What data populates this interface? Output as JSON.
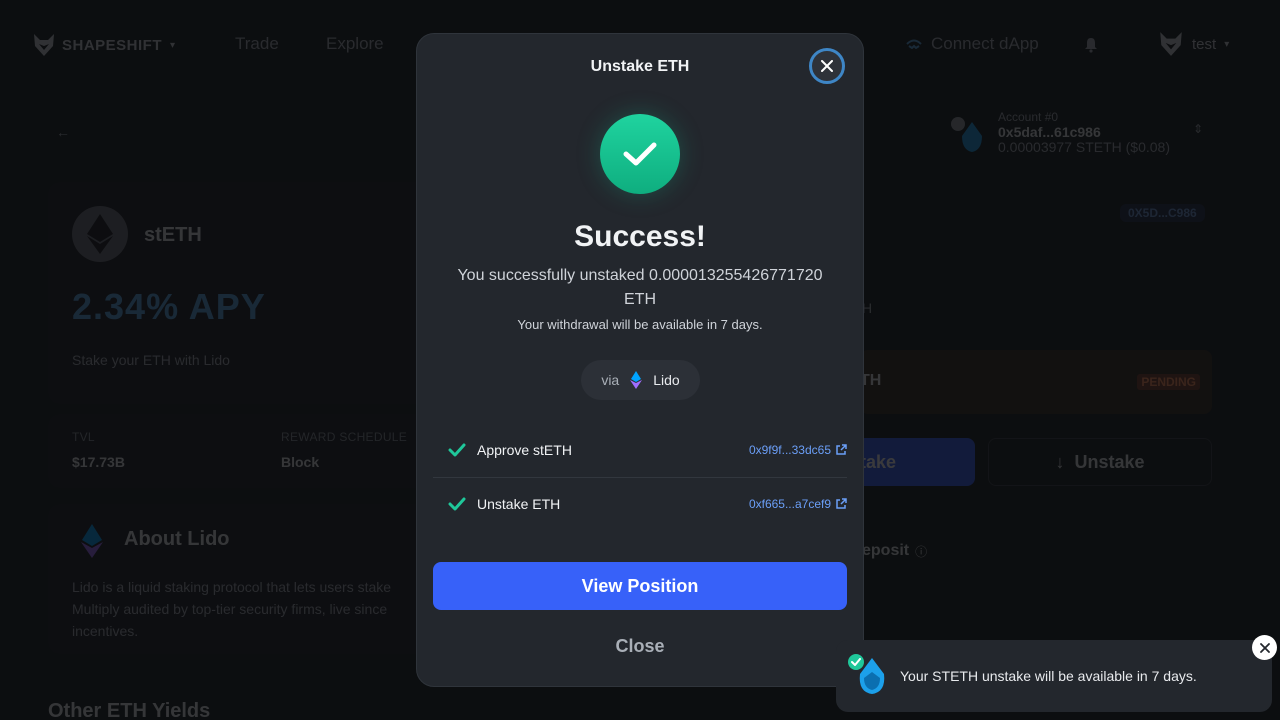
{
  "nav": {
    "brand": "SHAPESHIFT",
    "links": [
      "Trade",
      "Explore"
    ],
    "connect": "Connect dApp",
    "user": "test"
  },
  "asset": {
    "name": "stETH",
    "apy": "2.34% APY",
    "description": "Stake your ETH with Lido",
    "stats": [
      {
        "label": "TVL",
        "value": "$17.73B"
      },
      {
        "label": "REWARD SCHEDULE",
        "value": "Block"
      }
    ]
  },
  "about": {
    "title": "About Lido",
    "text_lines": [
      "Lido is a liquid staking protocol that lets users stake",
      "Multiply audited by top-tier security firms, live since",
      "incentives."
    ]
  },
  "other_title": "Other ETH Yields",
  "account": {
    "label": "Account #0",
    "address": "0x5daf...61c986",
    "balance": "0.00003977 STETH ($0.08)"
  },
  "right_panel": {
    "address_badge": "0X5D...C986",
    "partial_h": "H",
    "pending_partial": "TH",
    "pending_badge": "PENDING",
    "stake_partial": "take",
    "unstake": "Unstake",
    "deposit_partial": "eposit"
  },
  "modal": {
    "title": "Unstake ETH",
    "heading": "Success!",
    "message": "You successfully unstaked 0.000013255426771720 ETH",
    "note": "Your withdrawal will be available in 7 days.",
    "via_label": "via",
    "via_provider": "Lido",
    "transactions": [
      {
        "label": "Approve stETH",
        "hash": "0x9f9f...33dc65"
      },
      {
        "label": "Unstake ETH",
        "hash": "0xf665...a7cef9"
      }
    ],
    "primary_button": "View Position",
    "secondary_button": "Close"
  },
  "toast": {
    "message": "Your STETH unstake will be available in 7 days."
  },
  "colors": {
    "accent": "#3761f9",
    "success": "#1fc79a",
    "pending": "#ff8f5a"
  }
}
